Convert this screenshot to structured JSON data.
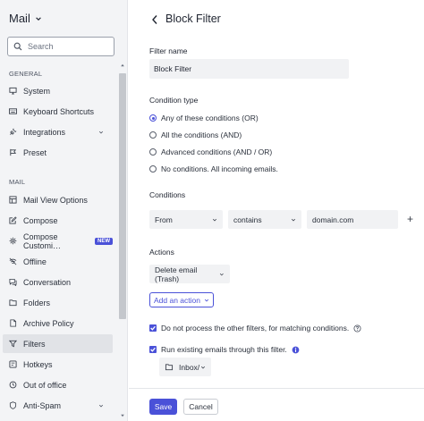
{
  "sidebar": {
    "app_title": "Mail",
    "search_placeholder": "Search",
    "general_label": "GENERAL",
    "mail_label": "MAIL",
    "general_items": [
      {
        "label": "System",
        "icon": "monitor-icon"
      },
      {
        "label": "Keyboard Shortcuts",
        "icon": "keyboard-icon"
      },
      {
        "label": "Integrations",
        "icon": "plug-icon"
      },
      {
        "label": "Preset",
        "icon": "preset-icon"
      }
    ],
    "mail_items": [
      {
        "label": "Mail View Options",
        "icon": "layout-icon"
      },
      {
        "label": "Compose",
        "icon": "compose-icon"
      },
      {
        "label": "Compose Customi…",
        "icon": "settings-icon",
        "badge": "NEW"
      },
      {
        "label": "Offline",
        "icon": "offline-icon"
      },
      {
        "label": "Conversation",
        "icon": "conversation-icon"
      },
      {
        "label": "Folders",
        "icon": "folder-icon"
      },
      {
        "label": "Archive Policy",
        "icon": "archive-icon"
      },
      {
        "label": "Filters",
        "icon": "filter-icon",
        "active": true
      },
      {
        "label": "Hotkeys",
        "icon": "hotkeys-icon"
      },
      {
        "label": "Out of office",
        "icon": "clock-icon"
      },
      {
        "label": "Anti-Spam",
        "icon": "shield-icon"
      }
    ]
  },
  "main": {
    "title": "Block Filter",
    "filter_name_label": "Filter name",
    "filter_name_value": "Block Filter",
    "condition_type_label": "Condition type",
    "condition_options": [
      {
        "label": "Any of these conditions (OR)",
        "selected": true
      },
      {
        "label": "All the conditions (AND)",
        "selected": false
      },
      {
        "label": "Advanced conditions (AND / OR)",
        "selected": false
      },
      {
        "label": "No conditions. All incoming emails.",
        "selected": false
      }
    ],
    "conditions_label": "Conditions",
    "condition_row": {
      "field": "From",
      "operator": "contains",
      "value": "domain.com"
    },
    "actions_label": "Actions",
    "action_select": "Delete email (Trash)",
    "add_action_label": "Add an action",
    "checkbox_1": "Do not process the other filters, for matching conditions.",
    "checkbox_2": "Run existing emails through this filter.",
    "folder_select": "Inbox/",
    "save_label": "Save",
    "cancel_label": "Cancel"
  },
  "colors": {
    "accent": "#4a51d8",
    "sidebar_bg": "#f3f4f6",
    "input_bg": "#f1f2f4"
  }
}
